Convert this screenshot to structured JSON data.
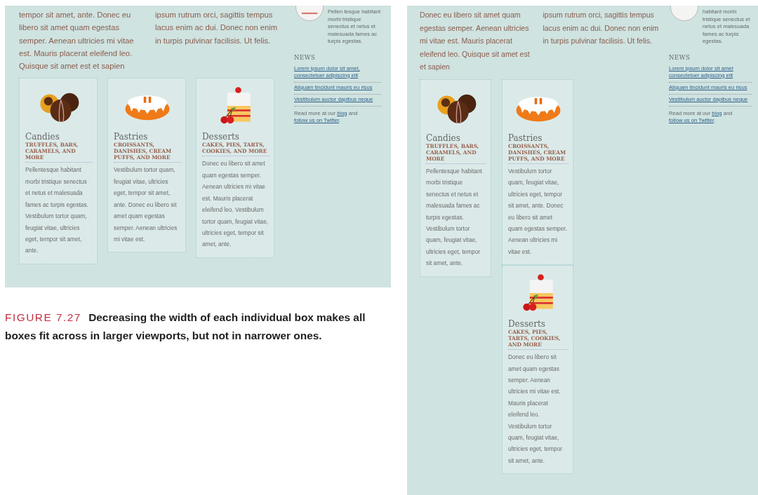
{
  "panels": [
    {
      "intro_columns": [
        "tempor sit amet, ante. Donec eu libero sit amet quam egestas semper. Aenean ultricies mi vitae est. Mauris placerat eleifend leo. Quisque sit amet est et sapien",
        "ipsum rutrum orci, sagittis tempus lacus enim ac dui. Donec non enim in turpis pulvinar facilisis. Ut felis."
      ],
      "sidebar": {
        "blurb": "Pellen tesque habitant morbi tristique senectus et netus et malesuada fames ac turpis egestas.",
        "news_heading": "NEWS",
        "news": [
          "Lorem ipsum dolor sit amet, consectetuer adipiscing elit",
          "Aliquam tincidunt mauris eu risus",
          "Vestibulum auctor dapibus neque"
        ],
        "footer": [
          {
            "kind": "text",
            "text": "Read more at our"
          },
          {
            "kind": "link",
            "text": "blog"
          },
          {
            "kind": "text",
            "text": "and"
          },
          {
            "kind": "link",
            "text": "follow us on Twitter"
          },
          {
            "kind": "text",
            "text": "."
          }
        ]
      },
      "categories": [
        {
          "kind": "candies",
          "name": "Candies",
          "subtitle": "TRUFFLES, BARS, CARAMELS, AND MORE",
          "text": "Pellentesque habitant morbi tristique senectus et netus et malesuada fames ac turpis egestas. Vestibulum tortor quam, feugiat vitae, ultricies eget, tempor sit amet, ante."
        },
        {
          "kind": "pastries",
          "name": "Pastries",
          "subtitle": "CROISSANTS, DANISHES, CREAM PUFFS, AND MORE",
          "text": "Vestibulum tortor quam, feugiat vitae, ultricies eget, tempor sit amet, ante. Donec eu libero sit amet quam egestas semper. Aenean ultricies mi vitae est."
        },
        {
          "kind": "desserts",
          "name": "Desserts",
          "subtitle": "CAKES, PIES, TARTS, COOKIES, AND MORE",
          "text": "Donec eu libero sit amet quam egestas semper. Aenean ultricies mi vitae est. Mauris placerat eleifend leo. Vestibulum tortor quam, feugiat vitae, ultricies eget, tempor sit amet, ante."
        }
      ]
    },
    {
      "intro_columns": [
        "Donec eu libero sit amet quam egestas semper. Aenean ultricies mi vitae est. Mauris placerat eleifend leo. Quisque sit amet est et sapien",
        "ipsum rutrum orci, sagittis tempus lacus enim ac dui. Donec non enim in turpis pulvinar facilisis. Ut felis."
      ],
      "sidebar": {
        "blurb": "habitant morbi tristique senectus et netus et malesuada fames ac turpis egestas.",
        "news_heading": "NEWS",
        "news": [
          "Lorem ipsum dolor sit amet consectetuer adipiscing elit",
          "Aliquam tincidunt mauris eu risus",
          "Vestibulum auctor dapibus neque"
        ],
        "footer": [
          {
            "kind": "text",
            "text": "Read more at our"
          },
          {
            "kind": "link",
            "text": "blog"
          },
          {
            "kind": "text",
            "text": "and"
          },
          {
            "kind": "link",
            "text": "follow us on Twitter"
          },
          {
            "kind": "text",
            "text": "."
          }
        ]
      },
      "categories": [
        {
          "kind": "candies",
          "name": "Candies",
          "subtitle": "TRUFFLES, BARS, CARAMELS, AND MORE",
          "text": "Pellentesque habitant morbi tristique senectus et netus et malesuada fames ac turpis egestas. Vestibulum tortor quam, feugiat vitae, ultricies eget, tempor sit amet, ante."
        },
        {
          "kind": "pastries",
          "name": "Pastries",
          "subtitle": "CROISSANTS, DANISHES, CREAM PUFFS, AND MORE",
          "text": "Vestibulum tortor quam, feugiat vitae, ultricies eget, tempor sit amet, ante. Donec eu libero sit amet quam egestas semper. Aenean ultricies mi vitae est."
        },
        {
          "kind": "desserts",
          "name": "Desserts",
          "subtitle": "CAKES, PIES, TARTS, COOKIES, AND MORE",
          "text": "Donec eu libero sit amet quam egestas semper. Aenean ultricies mi vitae est. Mauris placerat eleifend leo. Vestibulum tortor quam, feugiat vitae, ultricies eget, tempor sit amet, ante."
        }
      ]
    }
  ],
  "caption": {
    "label": "FIGURE 7.27",
    "text": "Decreasing the width of each individual box makes all boxes fit across in larger viewports, but not in narrower ones."
  }
}
